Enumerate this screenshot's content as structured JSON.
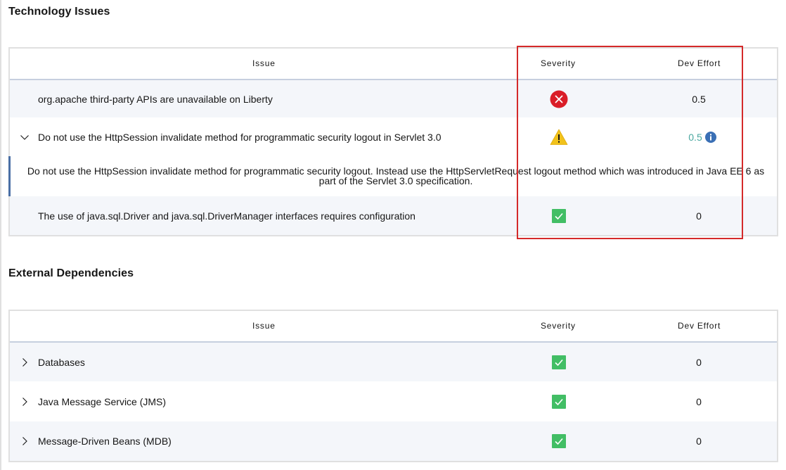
{
  "sections": {
    "technology": {
      "title": "Technology Issues",
      "headers": {
        "issue": "Issue",
        "severity": "Severity",
        "dev_effort": "Dev Effort"
      },
      "rows": [
        {
          "issue": "org.apache third-party APIs are unavailable on Liberty",
          "severity": "critical",
          "dev_effort": "0.5"
        },
        {
          "issue": "Do not use the HttpSession invalidate method for programmatic security logout in Servlet 3.0",
          "severity": "warning",
          "dev_effort": "0.5",
          "expanded": true,
          "detail": "Do not use the HttpSession invalidate method for programmatic security logout. Instead use the HttpServletRequest logout method which was introduced in Java EE 6 as part of the Servlet 3.0 specification."
        },
        {
          "issue": "The use of java.sql.Driver and java.sql.DriverManager interfaces requires configuration",
          "severity": "ok",
          "dev_effort": "0"
        }
      ]
    },
    "external": {
      "title": "External Dependencies",
      "headers": {
        "issue": "Issue",
        "severity": "Severity",
        "dev_effort": "Dev Effort"
      },
      "rows": [
        {
          "issue": "Databases",
          "severity": "ok",
          "dev_effort": "0"
        },
        {
          "issue": "Java Message Service (JMS)",
          "severity": "ok",
          "dev_effort": "0"
        },
        {
          "issue": "Message-Driven Beans (MDB)",
          "severity": "ok",
          "dev_effort": "0"
        }
      ]
    }
  },
  "icons": {
    "critical": "error-circle-icon",
    "warning": "warning-triangle-icon",
    "ok": "check-square-icon",
    "info": "info-icon",
    "chevron_down": "chevron-down-icon",
    "chevron_right": "chevron-right-icon"
  },
  "colors": {
    "critical": "#da1e28",
    "warning": "#f1c21b",
    "ok": "#42be65",
    "info": "#3a6fb5",
    "link": "#4aa7a0",
    "highlight": "#d42a2a"
  }
}
